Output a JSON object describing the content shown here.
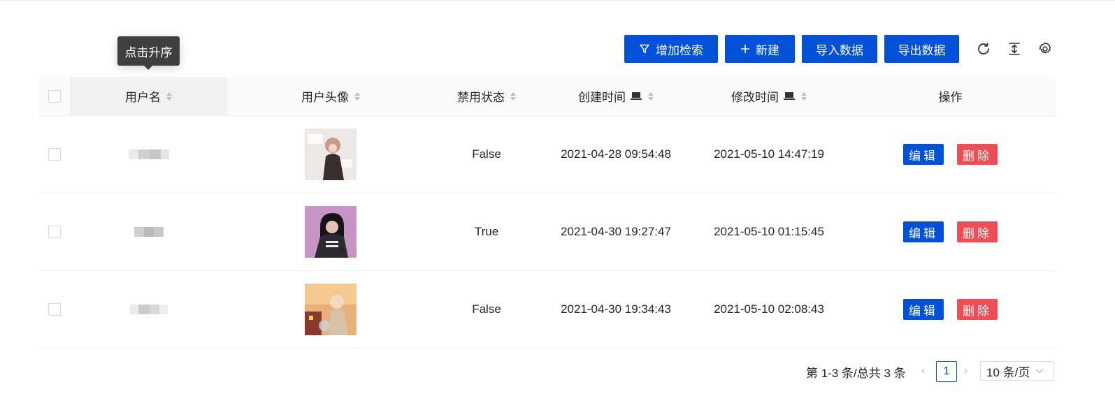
{
  "tooltip": {
    "text": "点击升序"
  },
  "toolbar": {
    "add_search_label": "增加检索",
    "new_label": "新建",
    "import_label": "导入数据",
    "export_label": "导出数据",
    "icons": [
      "refresh-icon",
      "density-icon",
      "settings-icon"
    ],
    "primary_color": "#0050d8"
  },
  "table": {
    "columns": [
      "用户名",
      "用户头像",
      "禁用状态",
      "创建时间",
      "修改时间",
      "操作"
    ],
    "rows": [
      {
        "username": "",
        "disabled": "False",
        "created": "2021-04-28 09:54:48",
        "modified": "2021-05-10 14:47:19"
      },
      {
        "username": "",
        "disabled": "True",
        "created": "2021-04-30 19:27:47",
        "modified": "2021-05-10 01:15:45"
      },
      {
        "username": "",
        "disabled": "False",
        "created": "2021-04-30 19:34:43",
        "modified": "2021-05-10 02:08:43"
      }
    ],
    "edit_label": "编辑",
    "delete_label": "删除",
    "delete_color": "#f04e55"
  },
  "pagination": {
    "total_text": "第 1-3 条/总共 3 条",
    "current_page": "1",
    "page_size": "10 条/页"
  }
}
